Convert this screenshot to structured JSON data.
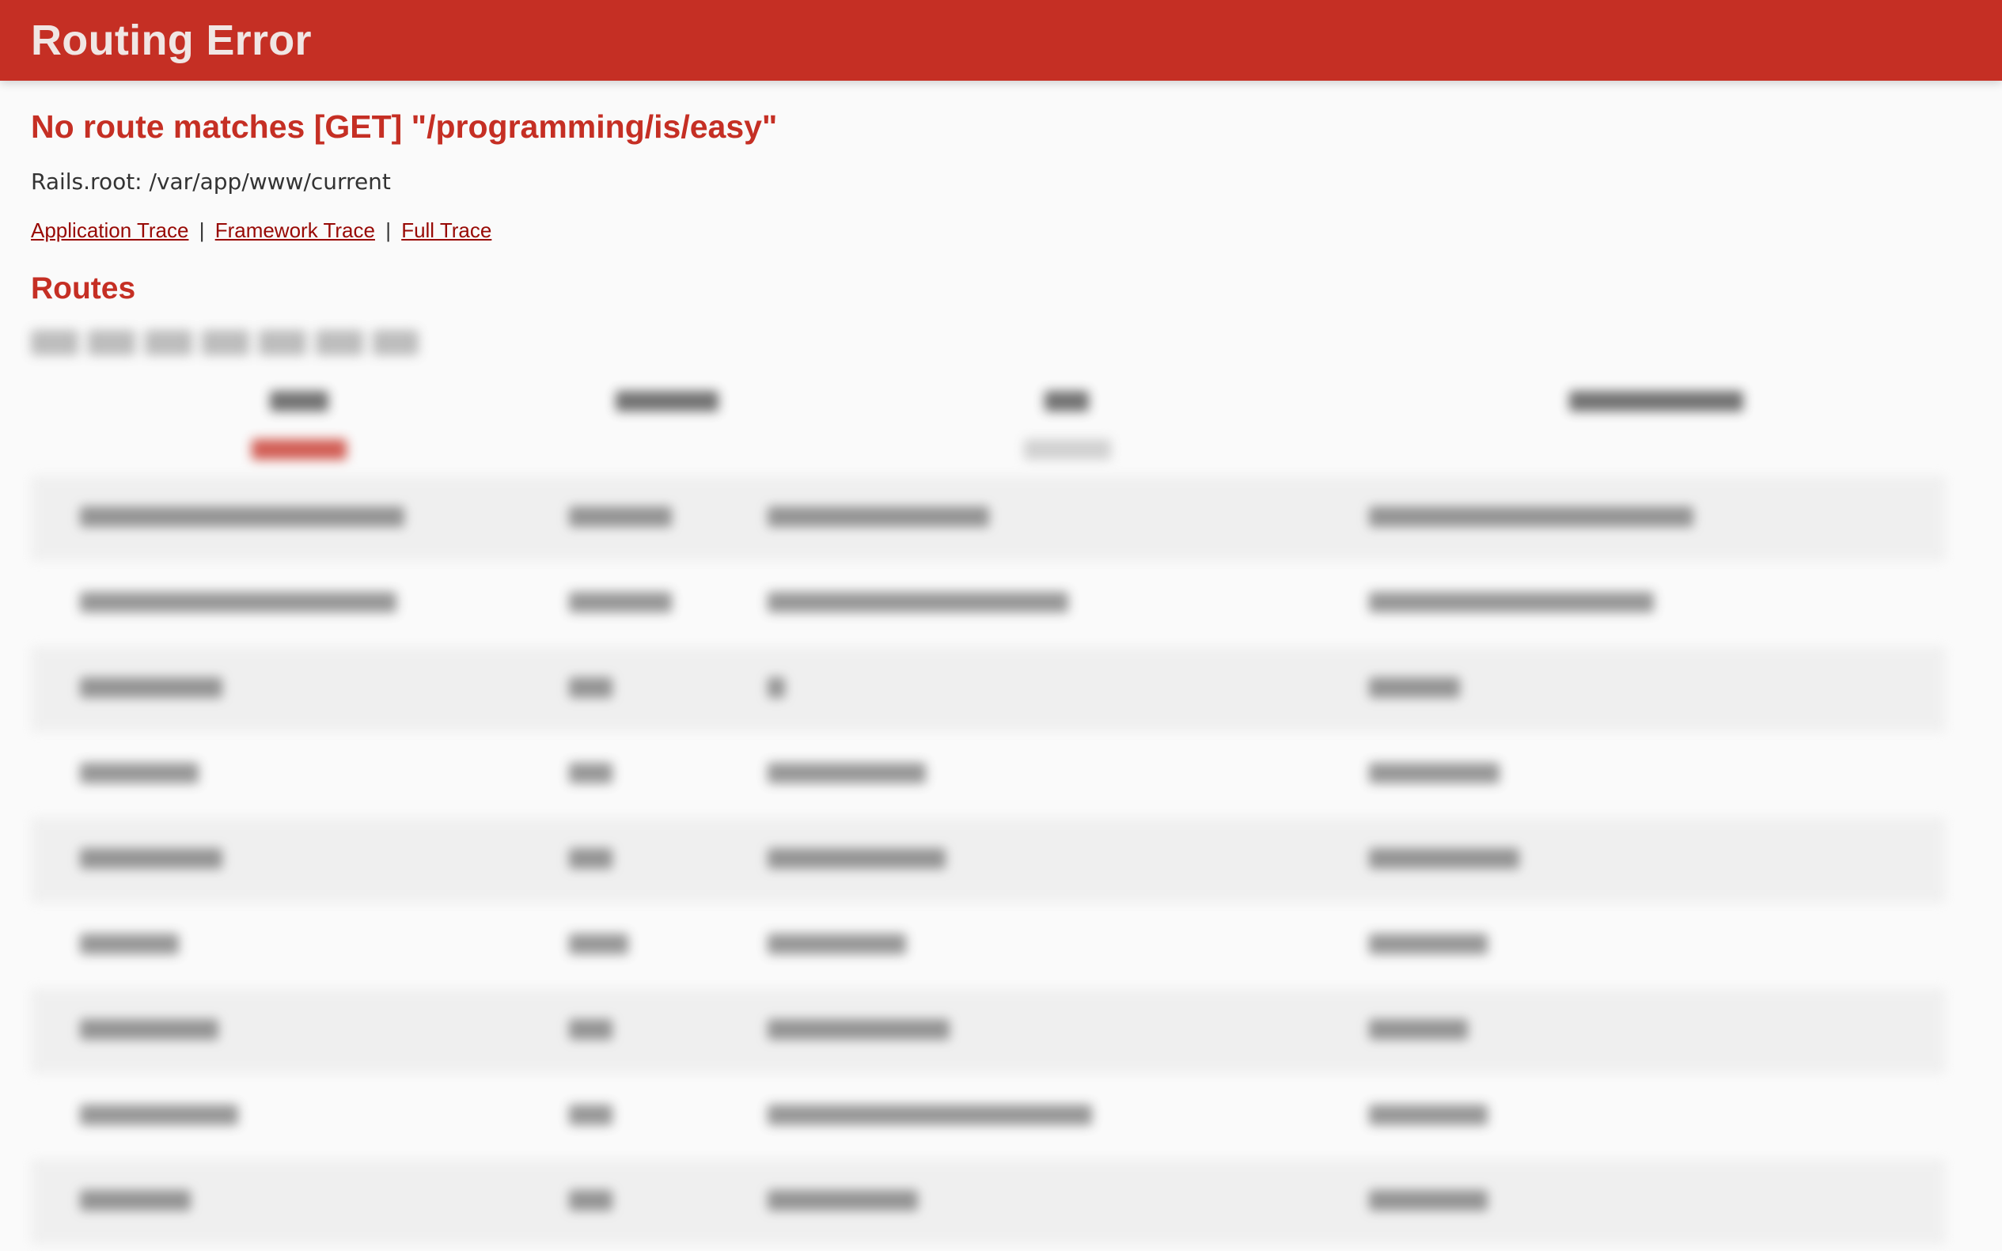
{
  "header": {
    "title": "Routing Error"
  },
  "error": {
    "message": "No route matches [GET] \"/programming/is/easy\"",
    "rails_root": "Rails.root: /var/app/www/current"
  },
  "trace_links": {
    "application": "Application Trace",
    "separator": "|",
    "framework": "Framework Trace",
    "full": "Full Trace"
  },
  "routes": {
    "title": "Routes",
    "content_blurred": true
  },
  "colors": {
    "header_bg": "#c52f24",
    "error_text": "#c52f24",
    "link": "#980905",
    "page_bg": "#fafafa"
  }
}
